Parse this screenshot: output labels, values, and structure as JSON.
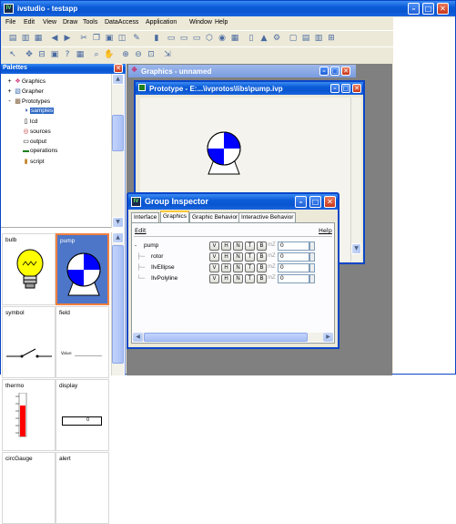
{
  "app": {
    "title": "ivstudio - testapp",
    "logo_text": "IV",
    "menu": [
      "File",
      "Edit",
      "View",
      "Draw",
      "Tools",
      "DataAccess",
      "Application",
      "Window",
      "Help"
    ]
  },
  "palettes": {
    "title": "Palettes",
    "tree": [
      {
        "label": "Graphics",
        "icon": "graphics-icon",
        "level": 0,
        "expander": "+"
      },
      {
        "label": "Grapher",
        "icon": "grapher-icon",
        "level": 0,
        "expander": "+"
      },
      {
        "label": "Prototypes",
        "icon": "prototypes-icon",
        "level": 0,
        "expander": "-"
      },
      {
        "label": "samples",
        "icon": "samples-icon",
        "level": 1,
        "selected": true
      },
      {
        "label": "lcd",
        "icon": "lcd-icon",
        "level": 1
      },
      {
        "label": "sources",
        "icon": "sources-icon",
        "level": 1
      },
      {
        "label": "output",
        "icon": "output-icon",
        "level": 1
      },
      {
        "label": "operations",
        "icon": "operations-icon",
        "level": 1
      },
      {
        "label": "script",
        "icon": "script-icon",
        "level": 1
      }
    ],
    "cells": [
      {
        "label": "bulb"
      },
      {
        "label": "pump",
        "selected": true
      },
      {
        "label": "symbol"
      },
      {
        "label": "field",
        "field_text": "Value:"
      },
      {
        "label": "thermo"
      },
      {
        "label": "display",
        "display_value": "0"
      },
      {
        "label": "circGauge"
      },
      {
        "label": "alert"
      }
    ]
  },
  "graphics_window": {
    "title": "Graphics - unnamed"
  },
  "prototype_window": {
    "title": "Prototype - E:...\\ivprotos\\libs\\pump.ivp"
  },
  "group_inspector": {
    "title": "Group Inspector",
    "logo_text": "IV",
    "tabs": [
      "Interface",
      "Graphics",
      "Graphic Behavior",
      "Interactive Behavior"
    ],
    "active_tab": "Graphics",
    "edit_label": "Edit",
    "help_label": "Help",
    "buttons": [
      "V",
      "H",
      "N",
      "T",
      "B"
    ],
    "mz_label": "mZ",
    "rows": [
      {
        "name": "pump",
        "value": "0",
        "expander": "-"
      },
      {
        "name": "rotor",
        "value": "0"
      },
      {
        "name": "IlvEllipse",
        "value": "0"
      },
      {
        "name": "IlvPolyline",
        "value": "0"
      }
    ]
  },
  "colors": {
    "title_blue": "#0a5bd8",
    "selection_blue": "#316ac5",
    "pump_blue": "#0000ff",
    "bulb_yellow": "#ffff00",
    "thermo_red": "#ff0000",
    "tab_highlight": "#ffc83c"
  }
}
